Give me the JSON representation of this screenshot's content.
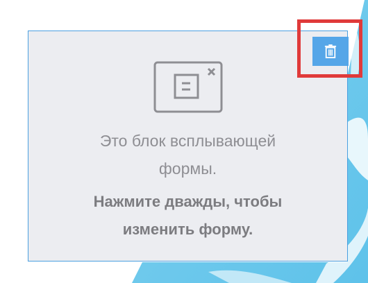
{
  "popup": {
    "text_line1": "Это блок всплывающей",
    "text_line2": "формы.",
    "hint_line1": "Нажмите дважды, чтобы",
    "hint_line2": "изменить форму."
  },
  "icons": {
    "form": "popup-form-icon",
    "delete": "trash-icon"
  },
  "colors": {
    "panel_bg": "#ecedf1",
    "panel_border": "#4a9fe0",
    "delete_bg": "#55a6e8",
    "highlight": "#e03a3a",
    "text": "#8e8e93"
  }
}
